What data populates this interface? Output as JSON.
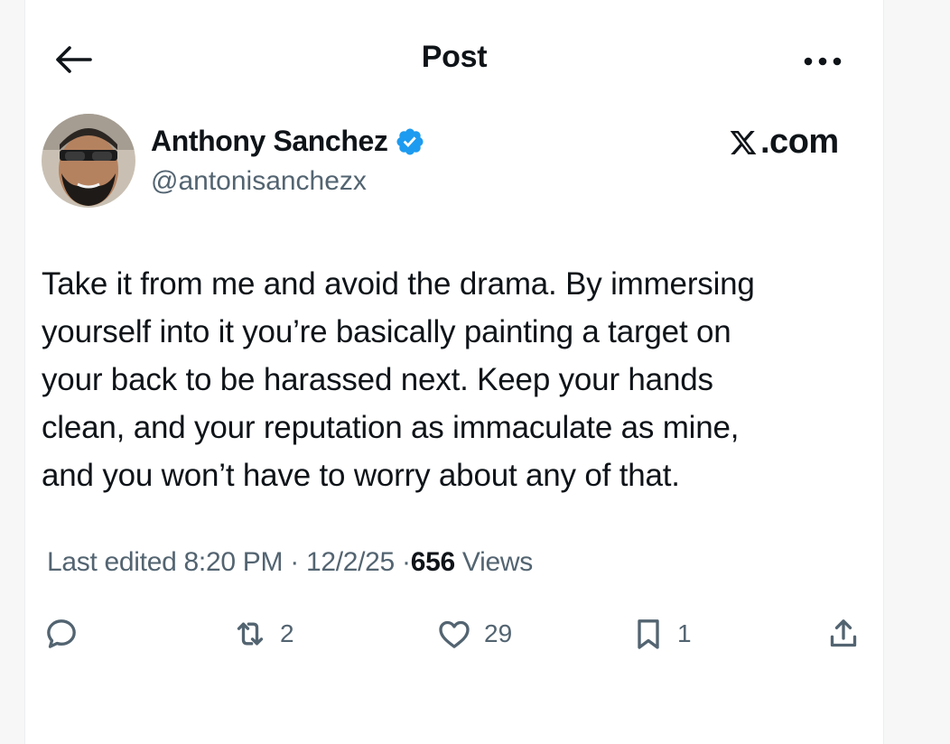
{
  "header": {
    "title": "Post",
    "back_icon": "arrow-left-icon",
    "more_icon": "more-horizontal-icon"
  },
  "author": {
    "name": "Anthony Sanchez",
    "handle": "@antonisanchezx",
    "verified": true,
    "verified_color": "#1d9bf0"
  },
  "watermark": {
    "text": ".com"
  },
  "post": {
    "text": "Take it from me and avoid the drama. By immersing\nyourself into it you’re basically painting a target on\nyour back to be harassed next. Keep your hands\nclean, and your reputation as immaculate as mine,\nand you won’t have to worry about any of that."
  },
  "meta": {
    "edited_label": "Last edited",
    "time": "8:20 PM",
    "separator": "·",
    "date": "12/2/25",
    "views_count": "656",
    "views_label": "Views"
  },
  "actions": {
    "reply": {
      "icon": "reply-icon"
    },
    "repost": {
      "icon": "repost-icon",
      "count": "2"
    },
    "like": {
      "icon": "heart-icon",
      "count": "29"
    },
    "bookmark": {
      "icon": "bookmark-icon",
      "count": "1"
    },
    "share": {
      "icon": "share-icon"
    }
  },
  "colors": {
    "text_primary": "#0f1419",
    "text_secondary": "#536471",
    "accent": "#1d9bf0"
  }
}
